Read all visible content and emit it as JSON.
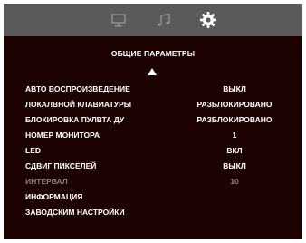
{
  "topbar": {
    "icons": [
      "monitor-icon",
      "music-icon",
      "gear-icon"
    ],
    "active": "gear-icon"
  },
  "menu": {
    "title": "ОБЩИЕ ПАРАМЕТРЫ",
    "items": [
      {
        "label": "АВТО ВОСПРОИЗВЕДЕНИЕ",
        "value": "ВЫКЛ",
        "enabled": true
      },
      {
        "label": "ЛОКАЛВНОЙ КЛАВИАТУРЫ",
        "value": "РАЗБЛОКИРОВАНО",
        "enabled": true
      },
      {
        "label": "БЛОКИРОВКА ПУЛВТА ДУ",
        "value": "РАЗБЛОКИРОВАНО",
        "enabled": true
      },
      {
        "label": "НОМЕР МОНИТОРА",
        "value": "1",
        "enabled": true
      },
      {
        "label": "LED",
        "value": "ВКЛ",
        "enabled": true
      },
      {
        "label": "СДВИГ ПИКСЕЛЕЙ",
        "value": "ВЫКЛ",
        "enabled": true
      },
      {
        "label": "ИНТЕРВАЛ",
        "value": "10",
        "enabled": false
      },
      {
        "label": "ИНФОРМАЦИЯ",
        "value": "",
        "enabled": true
      },
      {
        "label": "ЗАВОДСКИМ НАСТРОЙКИ",
        "value": "",
        "enabled": true
      }
    ]
  },
  "colors": {
    "background": "#1c0200",
    "topbar": "#5a5a5a",
    "text": "#ffffff",
    "disabled_text": "#8a7e7c"
  }
}
